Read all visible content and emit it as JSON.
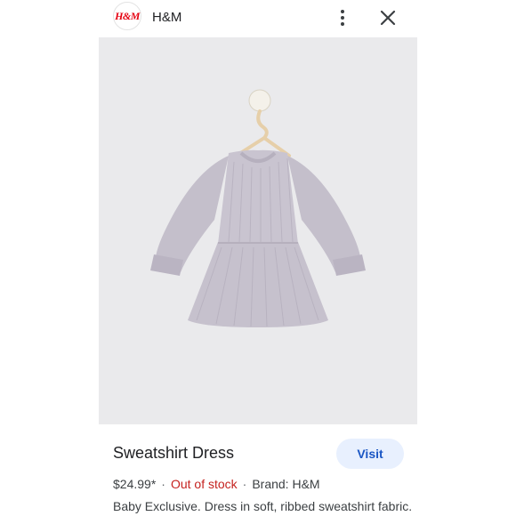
{
  "header": {
    "logo_text": "H&M",
    "site_name": "H&M",
    "menu_icon": "more-vert-icon",
    "close_icon": "close-icon"
  },
  "product": {
    "image_alt": "lilac ribbed sweatshirt dress on hanger",
    "garment_color": "#c7c2ce",
    "title": "Sweatshirt Dress",
    "visit_label": "Visit",
    "price": "$24.99*",
    "stock_status": "Out of stock",
    "brand": "Brand: H&M",
    "description": "Baby Exclusive. Dress in soft, ribbed sweatshirt fabric."
  },
  "colors": {
    "stock_red": "#c5221f",
    "visit_bg": "#e8f0fe",
    "visit_text": "#1a56c4",
    "image_bg": "#eaeaec"
  }
}
